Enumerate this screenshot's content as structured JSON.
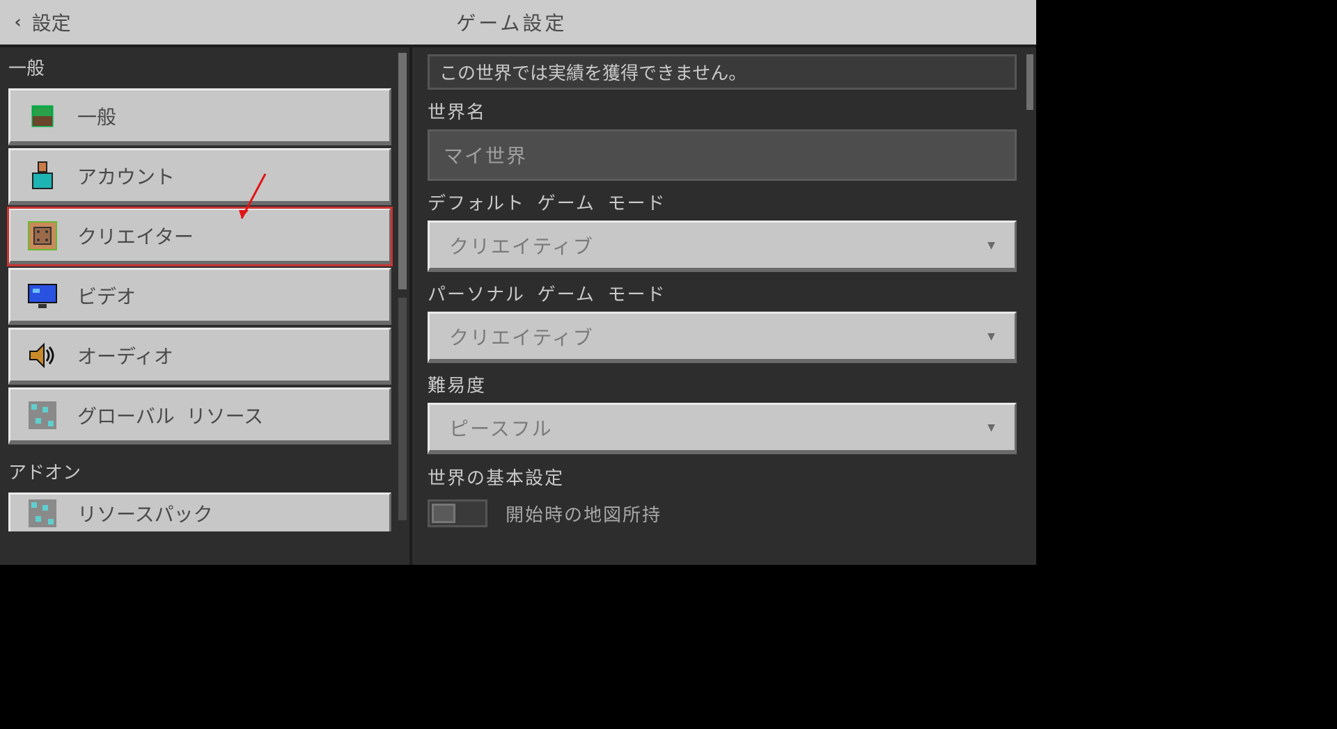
{
  "header": {
    "back_label": "設定",
    "page_title": "ゲーム設定"
  },
  "sidebar": {
    "categories": [
      {
        "label": "一般",
        "items": [
          {
            "icon": "cube-icon",
            "label": "一般"
          },
          {
            "icon": "account-icon",
            "label": "アカウント"
          },
          {
            "icon": "command-block-icon",
            "label": "クリエイター",
            "selected": true,
            "annotated": true
          },
          {
            "icon": "monitor-icon",
            "label": "ビデオ"
          },
          {
            "icon": "speaker-icon",
            "label": "オーディオ"
          },
          {
            "icon": "resource-icon",
            "label": "グローバル リソース"
          }
        ]
      },
      {
        "label": "アドオン",
        "items": [
          {
            "icon": "resource-icon",
            "label": "リソースパック",
            "partial": true
          }
        ]
      }
    ]
  },
  "main": {
    "notice": "この世界では実績を獲得できません。",
    "world_name": {
      "label": "世界名",
      "value": "マイ世界"
    },
    "default_mode": {
      "label": "デフォルト ゲーム モード",
      "value": "クリエイティブ"
    },
    "personal_mode": {
      "label": "パーソナル ゲーム モード",
      "value": "クリエイティブ"
    },
    "difficulty": {
      "label": "難易度",
      "value": "ピースフル"
    },
    "world_basic": {
      "label": "世界の基本設定"
    },
    "map_toggle": {
      "label": "開始時の地図所持",
      "value": false
    }
  },
  "annotation": {
    "arrow_color": "#e11515"
  }
}
